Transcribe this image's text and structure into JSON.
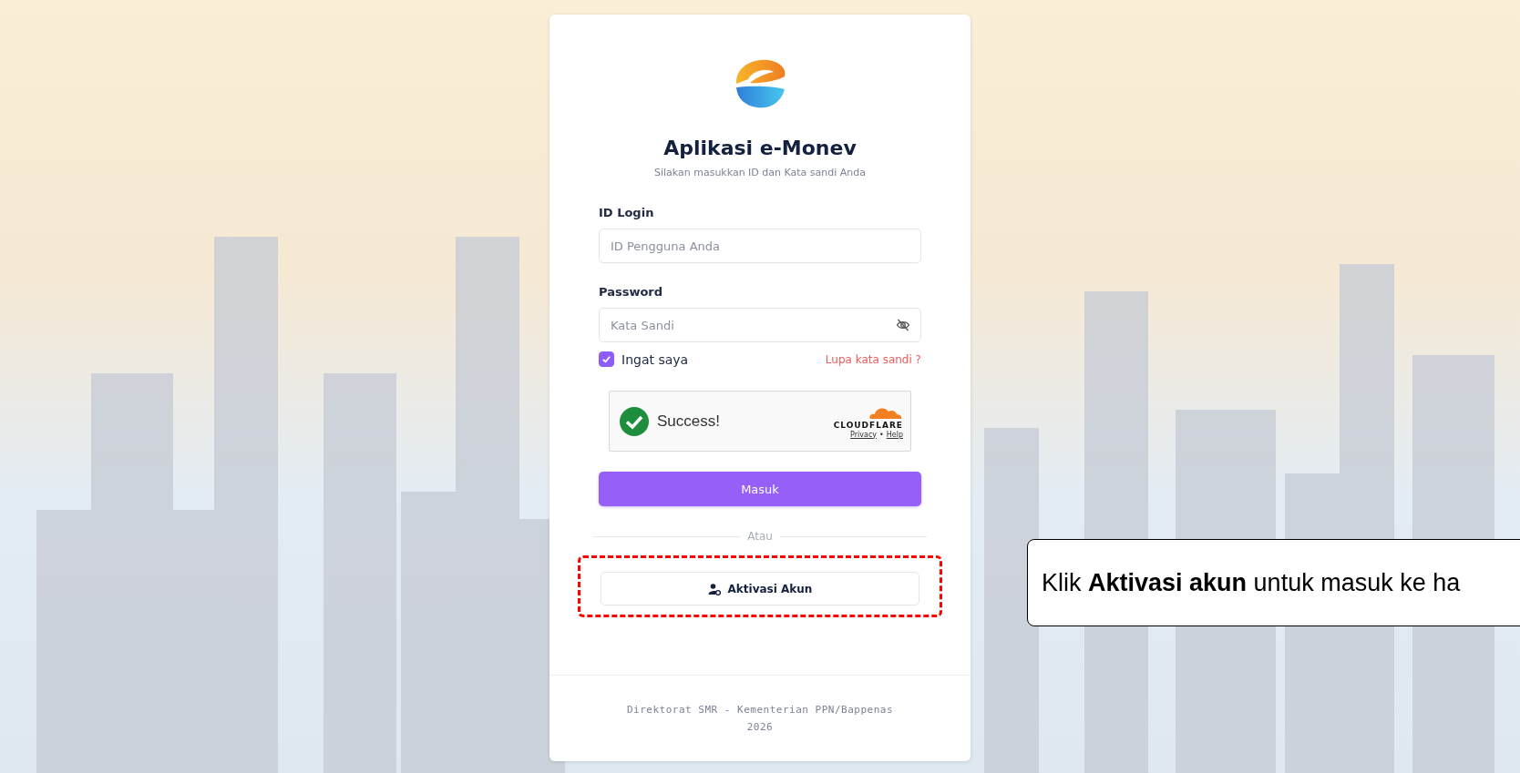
{
  "app": {
    "title": "Aplikasi e-Monev",
    "subtitle": "Silakan masukkan ID dan Kata sandi Anda"
  },
  "fields": [
    {
      "kind": "text",
      "label": "ID Login",
      "placeholder": "ID Pengguna Anda"
    },
    {
      "kind": "password",
      "label": "Password",
      "placeholder": "Kata Sandi"
    }
  ],
  "remember": {
    "label": "Ingat saya",
    "checked": true
  },
  "forgot_link": "Lupa kata sandi ?",
  "captcha": {
    "status": "Success!",
    "brand": "CLOUDFLARE",
    "links": [
      "Privacy",
      "Help"
    ],
    "separator": "•"
  },
  "submit_button": "Masuk",
  "divider": "Atau",
  "activation_button": {
    "label": "Aktivasi Akun",
    "highlighted": true
  },
  "footer": [
    "Direktorat SMR - Kementerian PPN/Bappenas",
    "2026"
  ],
  "callout": {
    "text": "Klik **Aktivasi akun** untuk masuk ke ha"
  }
}
